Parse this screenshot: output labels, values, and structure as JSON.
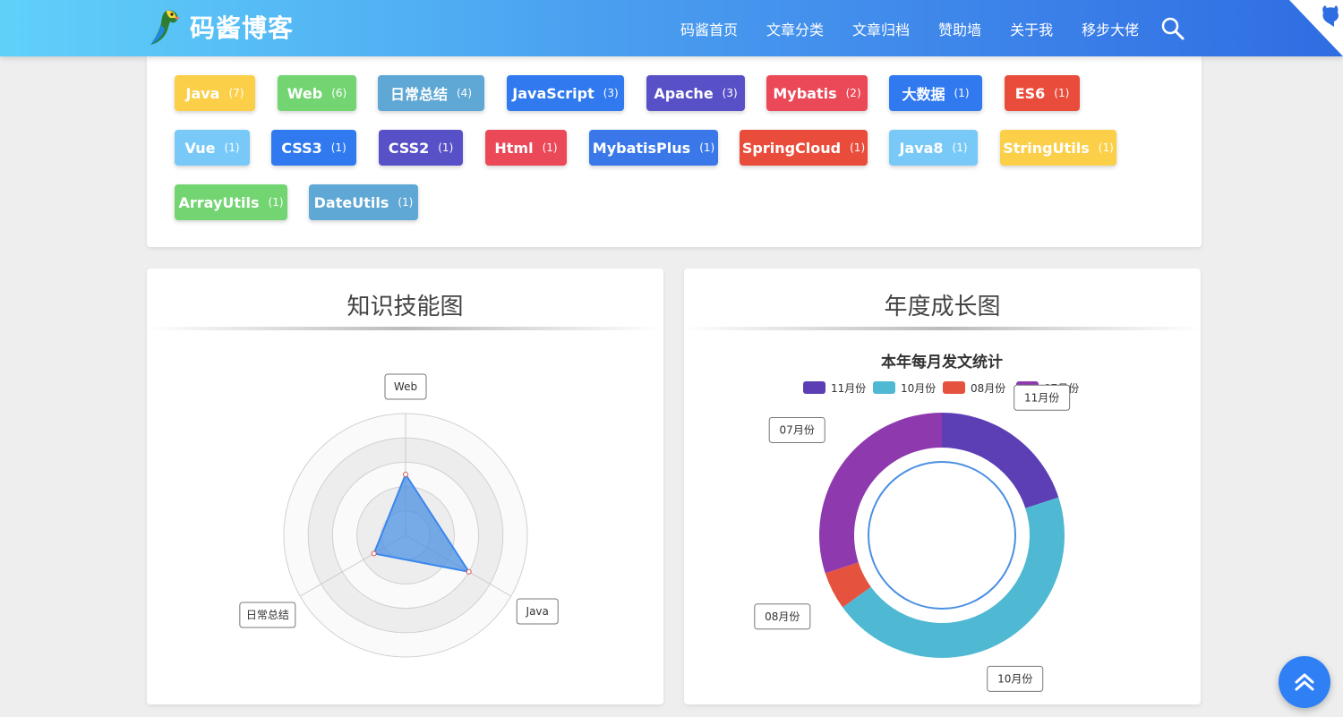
{
  "header": {
    "logo_text": "码酱博客",
    "nav": [
      "码酱首页",
      "文章分类",
      "文章归档",
      "赞助墙",
      "关于我",
      "移步大佬"
    ]
  },
  "tags": [
    {
      "name": "Java",
      "count": "(7)",
      "color": "#fbcf48"
    },
    {
      "name": "Web",
      "count": "(6)",
      "color": "#72d572"
    },
    {
      "name": "日常总结",
      "count": "(4)",
      "color": "#5fa7d4"
    },
    {
      "name": "JavaScript",
      "count": "(3)",
      "color": "#3079ee"
    },
    {
      "name": "Apache",
      "count": "(3)",
      "color": "#5850c7"
    },
    {
      "name": "Mybatis",
      "count": "(2)",
      "color": "#eb4858"
    },
    {
      "name": "大数据",
      "count": "(1)",
      "color": "#3079ee"
    },
    {
      "name": "ES6",
      "count": "(1)",
      "color": "#ea4c3b"
    },
    {
      "name": "Vue",
      "count": "(1)",
      "color": "#79c9f8"
    },
    {
      "name": "CSS3",
      "count": "(1)",
      "color": "#3079ee"
    },
    {
      "name": "CSS2",
      "count": "(1)",
      "color": "#5850c7"
    },
    {
      "name": "Html",
      "count": "(1)",
      "color": "#eb4858"
    },
    {
      "name": "MybatisPlus",
      "count": "(1)",
      "color": "#3a78ea"
    },
    {
      "name": "SpringCloud",
      "count": "(1)",
      "color": "#ea4c3b"
    },
    {
      "name": "Java8",
      "count": "(1)",
      "color": "#79c9f8"
    },
    {
      "name": "StringUtils",
      "count": "(1)",
      "color": "#fbcf48"
    },
    {
      "name": "ArrayUtils",
      "count": "(1)",
      "color": "#72d572"
    },
    {
      "name": "DateUtils",
      "count": "(1)",
      "color": "#5fa7d4"
    }
  ],
  "panels": {
    "skill_title": "知识技能图",
    "growth_title": "年度成长图"
  },
  "chart_data": [
    {
      "type": "radar",
      "indicators": [
        "Web",
        "Java",
        "日常总结"
      ],
      "max": 10,
      "values": [
        5,
        6,
        3
      ],
      "rings": 5,
      "colors": {
        "area": "#4a90e2",
        "line": "#3a86ee",
        "point": "#d9534f"
      }
    },
    {
      "type": "pie",
      "title": "本年每月发文统计",
      "legend": [
        "11月份",
        "10月份",
        "08月份",
        "07月份"
      ],
      "slices": [
        {
          "label": "11月份",
          "value": 4,
          "color": "#5c3fb5"
        },
        {
          "label": "10月份",
          "value": 9,
          "color": "#4fb8d2"
        },
        {
          "label": "08月份",
          "value": 1,
          "color": "#e5533f"
        },
        {
          "label": "07月份",
          "value": 6,
          "color": "#8e3aae"
        }
      ]
    }
  ]
}
